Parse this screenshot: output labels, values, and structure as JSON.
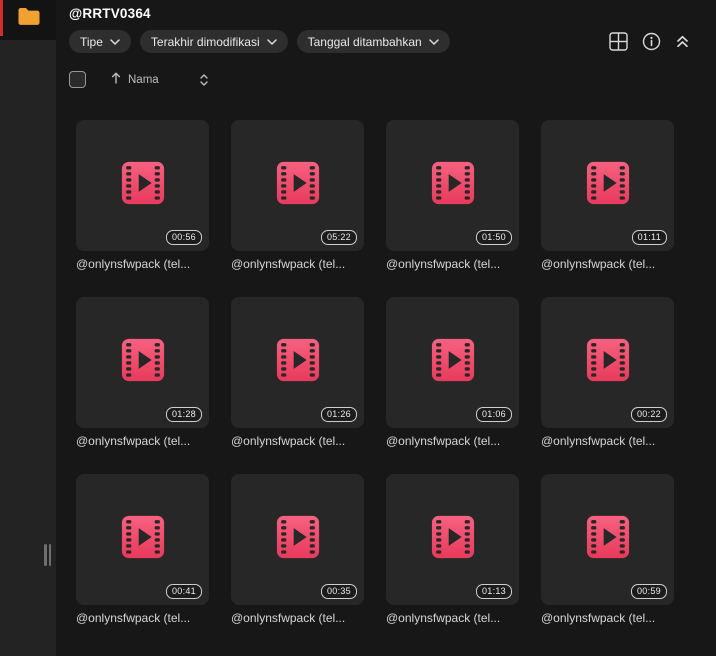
{
  "window": {
    "title": "@RRTV0364"
  },
  "rail": {
    "folder_icon": "folder-icon",
    "active_indicator_color": "#cf2e2e",
    "folder_color": "#f0a132"
  },
  "toolbar": {
    "chips": [
      {
        "label": "Tipe",
        "icon": "chevron-down-icon"
      },
      {
        "label": "Terakhir dimodifikasi",
        "icon": "chevron-down-icon"
      },
      {
        "label": "Tanggal ditambahkan",
        "icon": "chevron-down-icon"
      }
    ],
    "icons": [
      {
        "name": "grid-view-icon"
      },
      {
        "name": "info-icon"
      },
      {
        "name": "collapse-up-icon"
      }
    ]
  },
  "list_controls": {
    "select_all_checked": false,
    "sort_field": "Nama",
    "sort_direction": "ascending",
    "sort_icons": [
      "arrow-up-icon",
      "updown-chevrons-icon"
    ]
  },
  "files": [
    {
      "name": "@onlynsfwpack (tel...",
      "duration": "00:56",
      "type": "video",
      "icon": "film-icon"
    },
    {
      "name": "@onlynsfwpack (tel...",
      "duration": "05:22",
      "type": "video",
      "icon": "film-icon"
    },
    {
      "name": "@onlynsfwpack (tel...",
      "duration": "01:50",
      "type": "video",
      "icon": "film-icon"
    },
    {
      "name": "@onlynsfwpack (tel...",
      "duration": "01:11",
      "type": "video",
      "icon": "film-icon"
    },
    {
      "name": "@onlynsfwpack (tel...",
      "duration": "01:28",
      "type": "video",
      "icon": "film-icon"
    },
    {
      "name": "@onlynsfwpack (tel...",
      "duration": "01:26",
      "type": "video",
      "icon": "film-icon"
    },
    {
      "name": "@onlynsfwpack (tel...",
      "duration": "01:06",
      "type": "video",
      "icon": "film-icon"
    },
    {
      "name": "@onlynsfwpack (tel...",
      "duration": "00:22",
      "type": "video",
      "icon": "film-icon"
    },
    {
      "name": "@onlynsfwpack (tel...",
      "duration": "00:41",
      "type": "video",
      "icon": "film-icon"
    },
    {
      "name": "@onlynsfwpack (tel...",
      "duration": "00:35",
      "type": "video",
      "icon": "film-icon"
    },
    {
      "name": "@onlynsfwpack (tel...",
      "duration": "01:13",
      "type": "video",
      "icon": "film-icon"
    },
    {
      "name": "@onlynsfwpack (tel...",
      "duration": "00:59",
      "type": "video",
      "icon": "film-icon"
    }
  ],
  "colors": {
    "main_background": "#171717",
    "rail_background": "#232323",
    "rail_top_background": "#131313",
    "card_background": "#272727",
    "chip_background": "#2e2e2e",
    "accent_pink_top": "#f6617f",
    "accent_pink_bottom": "#e83a5c",
    "folder_orange": "#f0a132",
    "active_red": "#cf2e2e"
  }
}
